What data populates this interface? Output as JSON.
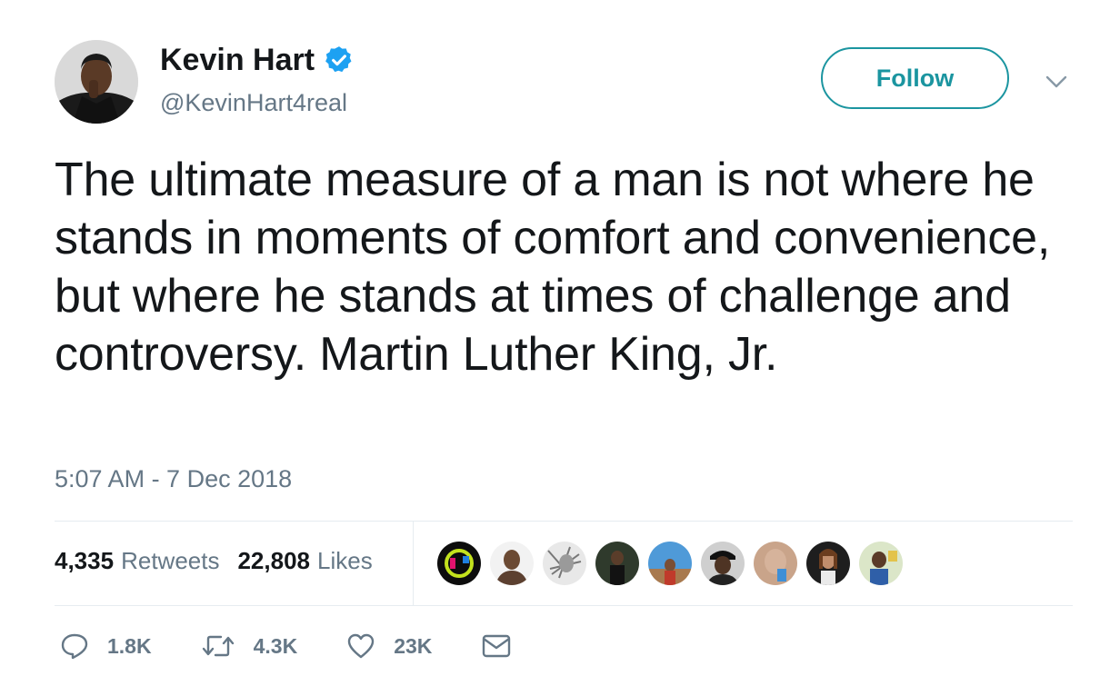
{
  "author": {
    "name": "Kevin Hart",
    "handle": "@KevinHart4real",
    "verified": true,
    "avatar_icon": "profile-photo"
  },
  "follow_button": {
    "label": "Follow"
  },
  "menu": {
    "icon": "chevron-down-icon"
  },
  "tweet": {
    "text": "The ultimate measure of a man is not where he stands in moments of comfort and convenience, but where he stands at times of challenge and controversy. Martin Luther King, Jr.",
    "timestamp": "5:07 AM - 7 Dec 2018"
  },
  "stats": {
    "retweets_count": "4,335",
    "retweets_label": "Retweets",
    "likes_count": "22,808",
    "likes_label": "Likes"
  },
  "likers": [
    {
      "icon": "liker-avatar-1"
    },
    {
      "icon": "liker-avatar-2"
    },
    {
      "icon": "liker-avatar-3"
    },
    {
      "icon": "liker-avatar-4"
    },
    {
      "icon": "liker-avatar-5"
    },
    {
      "icon": "liker-avatar-6"
    },
    {
      "icon": "liker-avatar-7"
    },
    {
      "icon": "liker-avatar-8"
    },
    {
      "icon": "liker-avatar-9"
    }
  ],
  "actions": {
    "reply": {
      "count": "1.8K",
      "icon": "reply-icon"
    },
    "retweet": {
      "count": "4.3K",
      "icon": "retweet-icon"
    },
    "like": {
      "count": "23K",
      "icon": "heart-icon"
    },
    "message": {
      "icon": "envelope-icon"
    }
  },
  "colors": {
    "accent": "#1b95a0",
    "verified": "#1da1f2",
    "text": "#14171a",
    "secondary": "#657786",
    "divider": "#e6ecf0"
  }
}
